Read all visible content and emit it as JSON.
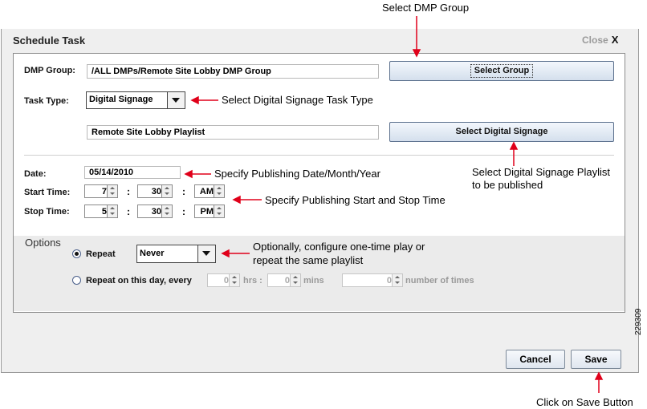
{
  "annotations": {
    "select_dmp_group": "Select DMP Group",
    "task_type": "Select Digital Signage Task Type",
    "digital_signage_line1": "Select Digital Signage Playlist",
    "digital_signage_line2": "to be published",
    "date": "Specify Publishing Date/Month/Year",
    "time": "Specify Publishing Start and Stop Time",
    "options_line1": "Optionally, configure one-time play or",
    "options_line2": "repeat the same playlist",
    "save": "Click on Save Button"
  },
  "dialog": {
    "title": "Schedule Task",
    "close_label": "Close",
    "close_x": "X"
  },
  "form": {
    "dmp_group_label": "DMP Group:",
    "dmp_group_value": "/ALL DMPs/Remote Site Lobby DMP Group",
    "select_group_button": "Select Group",
    "task_type_label": "Task Type:",
    "task_type_value": "Digital Signage",
    "playlist_value": "Remote Site Lobby Playlist",
    "select_signage_button": "Select Digital Signage",
    "date_label": "Date:",
    "date_value": "05/14/2010",
    "start_time_label": "Start Time:",
    "start_hour": "7",
    "start_minute": "30",
    "start_ampm": "AM",
    "stop_time_label": "Stop Time:",
    "stop_hour": "5",
    "stop_minute": "30",
    "stop_ampm": "PM",
    "colon": ":"
  },
  "options": {
    "heading": "Options",
    "repeat_label": "Repeat",
    "repeat_value": "Never",
    "repeat_day_label": "Repeat on this day, every",
    "hrs_value": "0",
    "hrs_label": "hrs :",
    "mins_value": "0",
    "mins_label": "mins",
    "times_value": "0",
    "times_label": "number of times"
  },
  "footer": {
    "cancel_button": "Cancel",
    "save_button": "Save"
  },
  "figure_id": "229309",
  "colors": {
    "annotation_arrow": "#e0001a",
    "button_border": "#5a6f8c"
  }
}
